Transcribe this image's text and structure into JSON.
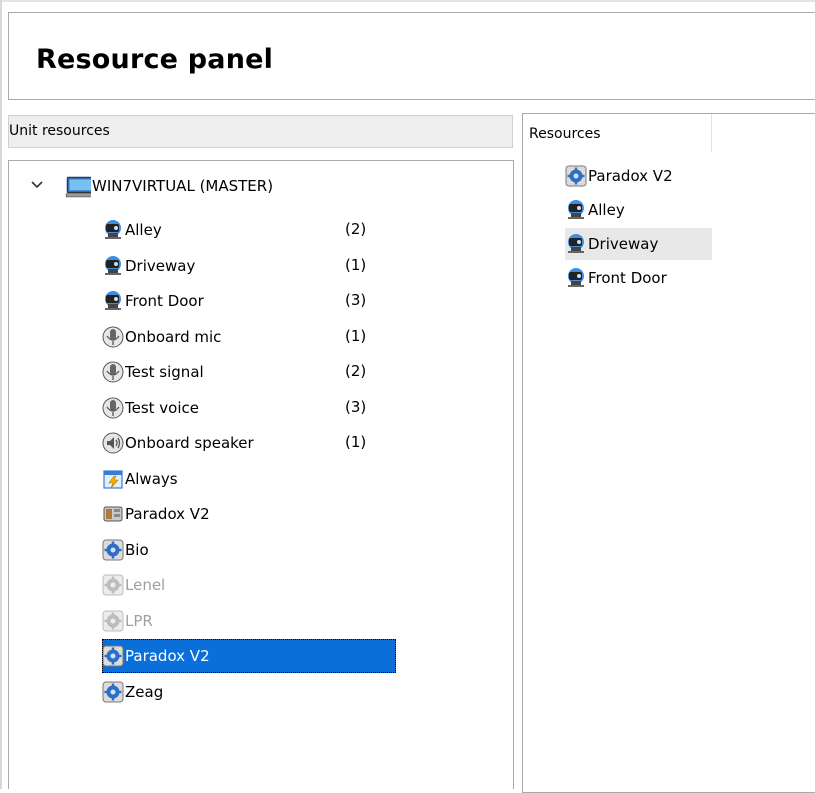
{
  "panel": {
    "title": "Resource panel"
  },
  "unit_resources": {
    "header": "Unit resources",
    "root": {
      "label": "WIN7VIRTUAL (MASTER)",
      "expanded": true,
      "icon": "computer-icon"
    },
    "items": [
      {
        "label": "Alley",
        "count": "(2)",
        "icon": "camera-icon",
        "state": "normal"
      },
      {
        "label": "Driveway",
        "count": "(1)",
        "icon": "camera-icon",
        "state": "normal"
      },
      {
        "label": "Front Door",
        "count": "(3)",
        "icon": "camera-icon",
        "state": "normal"
      },
      {
        "label": "Onboard mic",
        "count": "(1)",
        "icon": "microphone-icon",
        "state": "normal"
      },
      {
        "label": "Test signal",
        "count": "(2)",
        "icon": "microphone-icon",
        "state": "normal"
      },
      {
        "label": "Test voice",
        "count": "(3)",
        "icon": "microphone-icon",
        "state": "normal"
      },
      {
        "label": "Onboard speaker",
        "count": "(1)",
        "icon": "speaker-icon",
        "state": "normal"
      },
      {
        "label": "Always",
        "count": "",
        "icon": "schedule-icon",
        "state": "normal"
      },
      {
        "label": "Paradox V2",
        "count": "",
        "icon": "panel-icon",
        "state": "normal"
      },
      {
        "label": "Bio",
        "count": "",
        "icon": "gear-icon",
        "state": "normal"
      },
      {
        "label": "Lenel",
        "count": "",
        "icon": "gear-icon",
        "state": "disabled"
      },
      {
        "label": "LPR",
        "count": "",
        "icon": "gear-icon",
        "state": "disabled"
      },
      {
        "label": "Paradox V2",
        "count": "",
        "icon": "gear-icon",
        "state": "selected"
      },
      {
        "label": "Zeag",
        "count": "",
        "icon": "gear-icon",
        "state": "normal"
      }
    ]
  },
  "resources": {
    "header": "Resources",
    "items": [
      {
        "label": "Paradox V2",
        "icon": "gear-icon",
        "state": "normal"
      },
      {
        "label": "Alley",
        "icon": "camera-icon",
        "state": "normal"
      },
      {
        "label": "Driveway",
        "icon": "camera-icon",
        "state": "hover"
      },
      {
        "label": "Front Door",
        "icon": "camera-icon",
        "state": "normal"
      }
    ]
  },
  "colors": {
    "selection": "#0a6fd8",
    "hover": "#e8e8e8",
    "disabled_text": "#a0a0a0",
    "border": "#a9a9a9"
  }
}
